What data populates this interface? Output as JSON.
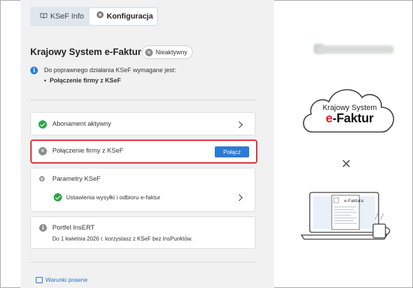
{
  "tabs": [
    {
      "label": "KSeF Info",
      "icon": "book-icon",
      "active": false
    },
    {
      "label": "Konfiguracja",
      "icon": "close-circle-icon",
      "active": true
    }
  ],
  "header": {
    "title": "Krajowy System e-Faktur",
    "status": "Nieaktywny"
  },
  "requirements": {
    "intro": "Do poprawnego działania KSeF wymagane jest:",
    "items": [
      "Połączenie firmy z KSeF"
    ]
  },
  "cards": {
    "subscription": {
      "label": "Abonament aktywny",
      "status": "ok"
    },
    "connection": {
      "label": "Połączenie firmy z KSeF",
      "button": "Połącz",
      "status": "inactive"
    },
    "params": {
      "label": "Parametry KSeF",
      "item": "Ustawienia wysyłki i odbioru e-faktur",
      "item_status": "ok"
    },
    "portfel": {
      "label": "Portfel InsERT",
      "description": "Do 1 kwietnia 2026 r. korzystasz z KSeF bez InsPunktów."
    }
  },
  "footer": {
    "link": "Warunki prawne"
  },
  "illustration": {
    "cloud_line1": "Krajowy System",
    "cloud_line2_prefix": "e",
    "cloud_line2_rest": "-Faktur",
    "times": "×",
    "laptop_label": "e-Faktura"
  },
  "colors": {
    "accent": "#2d7ad3",
    "success": "#2aa84a",
    "highlight_border": "#d9303b",
    "brand_red": "#d5202a"
  }
}
